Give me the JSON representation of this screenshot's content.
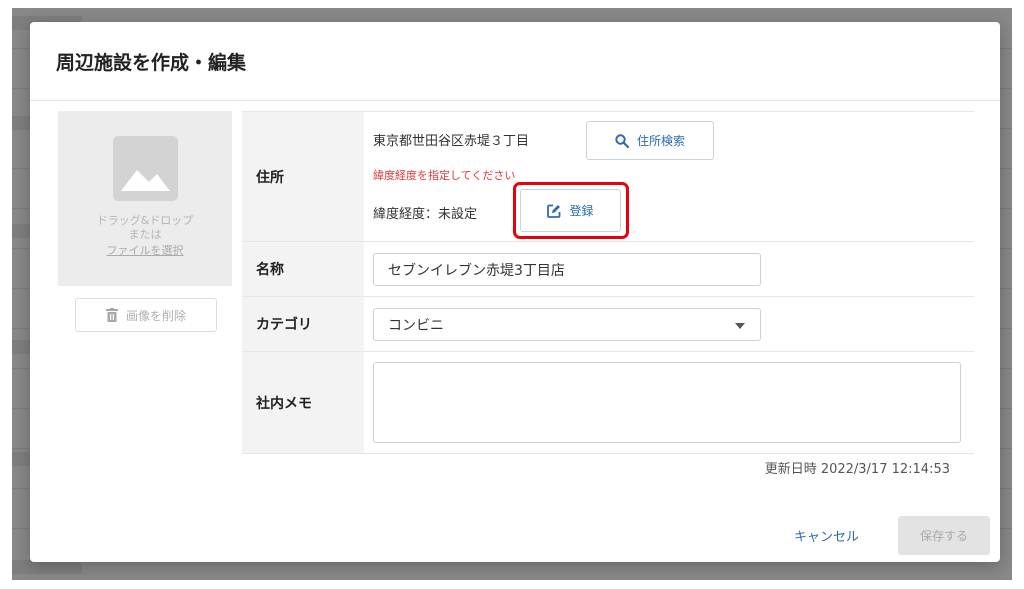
{
  "dialog": {
    "title": "周辺施設を作成・編集"
  },
  "image_panel": {
    "drop_line1": "ドラッグ&ドロップ",
    "drop_line2": "または",
    "file_link": "ファイルを選択",
    "delete_label": "画像を削除"
  },
  "form": {
    "address": {
      "label": "住所",
      "value": "東京都世田谷区赤堤３丁目",
      "search_button": "住所検索",
      "warning": "緯度経度を指定してください",
      "latlng_text": "緯度経度：未設定",
      "register_button": "登録"
    },
    "name": {
      "label": "名称",
      "value": "セブンイレブン赤堤3丁目店"
    },
    "category": {
      "label": "カテゴリ",
      "value": "コンビニ"
    },
    "memo": {
      "label": "社内メモ",
      "value": ""
    }
  },
  "updated": "更新日時 2022/3/17 12:14:53",
  "footer": {
    "cancel_label": "キャンセル",
    "save_label": "保存する"
  },
  "colors": {
    "accent": "#2b6cb0",
    "warning": "#e03a3a",
    "highlight": "#e8000b"
  }
}
